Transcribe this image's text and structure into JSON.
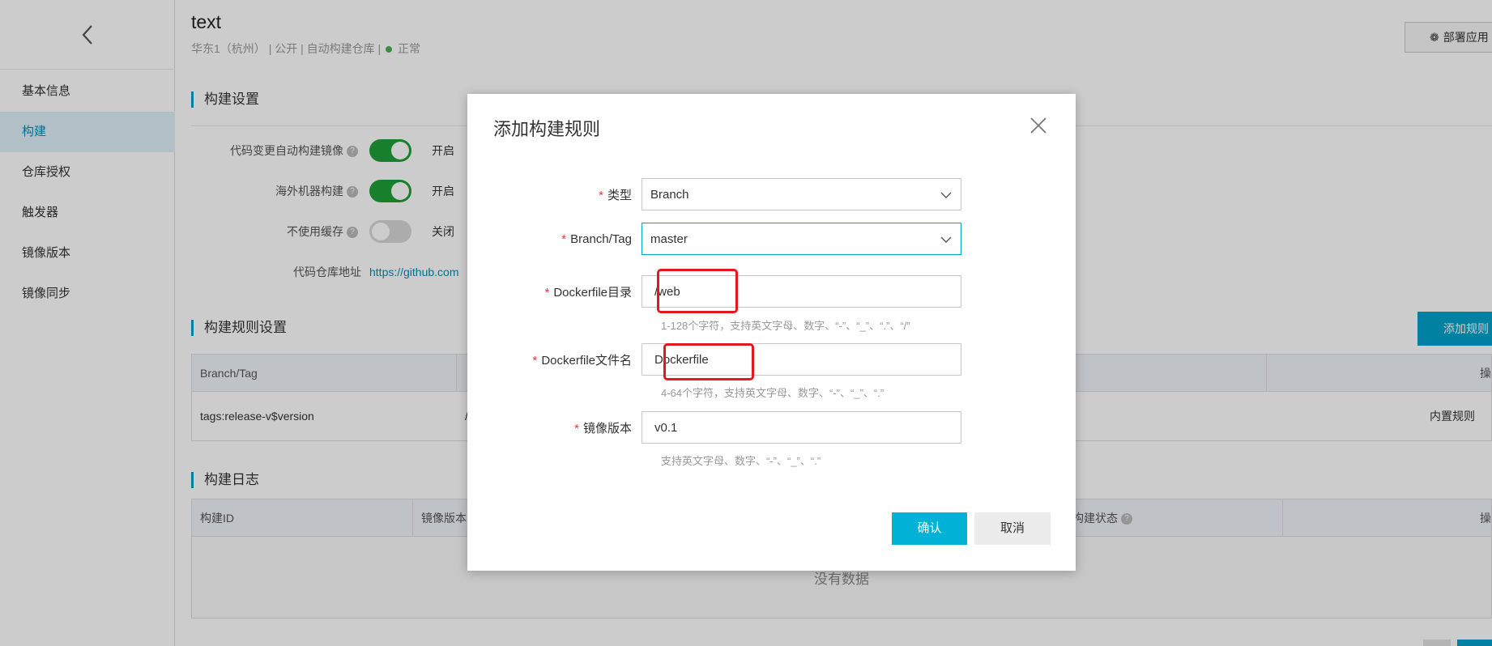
{
  "sidebar": {
    "back_icon": "chevron-left-icon",
    "items": [
      {
        "label": "基本信息",
        "active": false
      },
      {
        "label": "构建",
        "active": true
      },
      {
        "label": "仓库授权",
        "active": false
      },
      {
        "label": "触发器",
        "active": false
      },
      {
        "label": "镜像版本",
        "active": false
      },
      {
        "label": "镜像同步",
        "active": false
      }
    ]
  },
  "header": {
    "title": "text",
    "region": "华东1（杭州）",
    "visibility": "公开",
    "repo_type": "自动构建仓库",
    "status": "正常",
    "status_color": "#4cb050",
    "deploy_label": "部署应用"
  },
  "build_settings": {
    "title": "构建设置",
    "rows": [
      {
        "label": "代码变更自动构建镜像",
        "state": "开启",
        "on": true
      },
      {
        "label": "海外机器构建",
        "state": "开启",
        "on": true
      },
      {
        "label": "不使用缓存",
        "state": "关闭",
        "on": false
      }
    ],
    "repo_url_label": "代码仓库地址",
    "repo_url": "https://github.com"
  },
  "rule_settings": {
    "title": "构建规则设置",
    "add_label": "添加规则",
    "columns": [
      "Branch/Tag",
      "",
      "",
      "",
      "操"
    ],
    "rows": [
      {
        "branch": "tags:release-v$version",
        "dir": "/",
        "action": "内置规则"
      }
    ]
  },
  "build_log": {
    "title": "构建日志",
    "columns": [
      "构建ID",
      "镜像版本",
      "",
      "",
      "构建状态",
      "操"
    ],
    "empty_text": "没有数据"
  },
  "modal": {
    "title": "添加构建规则",
    "fields": [
      {
        "label": "类型",
        "value": "Branch"
      },
      {
        "label": "Branch/Tag",
        "value": "master"
      },
      {
        "label": "Dockerfile目录",
        "value": "/web",
        "hint": "1-128个字符，支持英文字母、数字、“-”、“_”、“.”、“/”"
      },
      {
        "label": "Dockerfile文件名",
        "value": "Dockerfile",
        "hint": "4-64个字符，支持英文字母、数字、“-”、“_”、“.”"
      },
      {
        "label": "镜像版本",
        "value": "v0.1",
        "hint": "支持英文字母、数字、“-”、“_”、“.”"
      }
    ],
    "ok_label": "确认",
    "cancel_label": "取消"
  },
  "colors": {
    "accent": "#00a2ca",
    "switch_on": "#1fa138",
    "highlight": "#e4161e",
    "brand": "#ff6a00"
  }
}
